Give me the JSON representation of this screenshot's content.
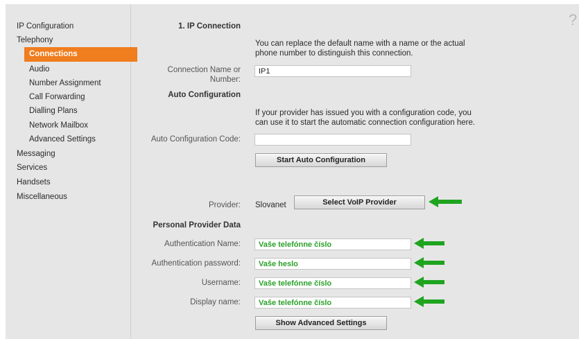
{
  "sidebar": {
    "items": [
      {
        "label": "IP Configuration"
      },
      {
        "label": "Telephony"
      },
      {
        "label": "Connections"
      },
      {
        "label": "Audio"
      },
      {
        "label": "Number Assignment"
      },
      {
        "label": "Call Forwarding"
      },
      {
        "label": "Dialling Plans"
      },
      {
        "label": "Network Mailbox"
      },
      {
        "label": "Advanced Settings"
      },
      {
        "label": "Messaging"
      },
      {
        "label": "Services"
      },
      {
        "label": "Handsets"
      },
      {
        "label": "Miscellaneous"
      }
    ]
  },
  "help_icon": "?",
  "ip_connection": {
    "heading": "1. IP Connection",
    "description_line1": "You can replace the default name with a name or the actual",
    "description_line2": "phone number to distinguish this connection.",
    "name_label_line1": "Connection Name or",
    "name_label_line2": "Number:",
    "name_value": "IP1"
  },
  "auto_configuration": {
    "heading": "Auto Configuration",
    "description_line1": "If your provider has issued you with a configuration code, you",
    "description_line2": "can use it to start the automatic connection configuration here.",
    "code_label": "Auto Configuration Code:",
    "code_value": "",
    "start_button": "Start Auto Configuration"
  },
  "provider": {
    "label": "Provider:",
    "value": "Slovanet",
    "select_button": "Select VoIP Provider"
  },
  "personal_data": {
    "heading": "Personal Provider Data",
    "auth_name_label": "Authentication Name:",
    "auth_name_value": "Vaše telefónne číslo",
    "auth_password_label": "Authentication password:",
    "auth_password_value": "Vaše heslo",
    "username_label": "Username:",
    "username_value": "Vaše telefónne číslo",
    "display_name_label": "Display name:",
    "display_name_value": "Vaše telefónne číslo",
    "advanced_button": "Show Advanced Settings"
  },
  "colors": {
    "accent": "#f07d1e",
    "arrow": "#1fa41f",
    "field_text": "#2aa12a"
  }
}
